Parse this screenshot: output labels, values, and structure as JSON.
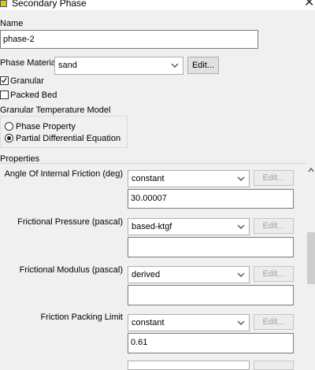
{
  "window": {
    "title": "Secondary Phase",
    "close_glyph": "✕",
    "icon": "app-icon"
  },
  "name_section": {
    "label": "Name",
    "value": "phase-2"
  },
  "phase_material": {
    "label": "Phase Material",
    "selected": "sand",
    "edit_label": "Edit..."
  },
  "options": {
    "granular": {
      "label": "Granular",
      "checked": true
    },
    "packed_bed": {
      "label": "Packed Bed",
      "checked": false
    }
  },
  "granular_temperature_model": {
    "label": "Granular Temperature Model",
    "options": [
      {
        "label": "Phase Property",
        "selected": false
      },
      {
        "label": "Partial Differential Equation",
        "selected": true
      }
    ]
  },
  "properties": {
    "label": "Properties",
    "items": [
      {
        "label": "Angle Of Internal Friction (deg)",
        "method": "constant",
        "value": "30.00007",
        "edit_label": "Edit..."
      },
      {
        "label": "Frictional Pressure (pascal)",
        "method": "based-ktgf",
        "value": "",
        "edit_label": "Edit..."
      },
      {
        "label": "Frictional Modulus (pascal)",
        "method": "derived",
        "value": "",
        "edit_label": "Edit..."
      },
      {
        "label": "Friction Packing Limit",
        "method": "constant",
        "value": "0.61",
        "edit_label": "Edit..."
      }
    ]
  },
  "colors": {
    "window_bg": "#f0f0f0",
    "input_border": "#7a7a7a",
    "disabled_text": "#a0a0a0",
    "scroll_thumb": "#cdcdcd"
  }
}
